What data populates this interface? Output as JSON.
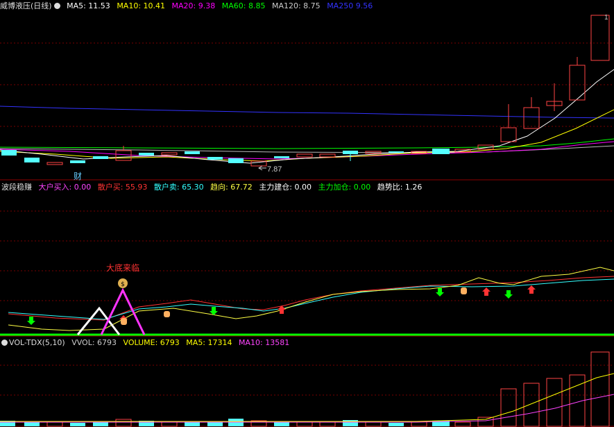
{
  "main_panel": {
    "title": "威博液压",
    "period": "(日线)",
    "ma": [
      {
        "label": "MA5: 11.53",
        "color": "#ffffff"
      },
      {
        "label": "MA10: 10.41",
        "color": "#ffff00"
      },
      {
        "label": "MA20: 9.38",
        "color": "#ff00ff"
      },
      {
        "label": "MA60: 8.85",
        "color": "#00ff00"
      },
      {
        "label": "MA120: 8.75",
        "color": "#cccccc"
      },
      {
        "label": "MA250 9.56",
        "color": "#3333ff"
      }
    ],
    "low_marker": "7.87",
    "finance_marker": "财",
    "top_marker": "1"
  },
  "indicator_panel": {
    "title": "波段稳赚",
    "items": [
      {
        "label": "大户买入: 0.00",
        "color": "#ff44ff"
      },
      {
        "label": "散户买: 55.93",
        "color": "#ff3333"
      },
      {
        "label": "散户卖: 65.30",
        "color": "#33ffff"
      },
      {
        "label": "趋向: 67.72",
        "color": "#ffff44"
      },
      {
        "label": "主力建仓: 0.00",
        "color": "#ffffff"
      },
      {
        "label": "主力加仓: 0.00",
        "color": "#00ff00"
      },
      {
        "label": "趋势比: 1.26",
        "color": "#ffffff"
      }
    ],
    "annotation": "大底来临"
  },
  "volume_panel": {
    "title": "VOL-TDX(5,10)",
    "items": [
      {
        "label": "VVOL: 6793",
        "color": "#cccccc"
      },
      {
        "label": "VOLUME: 6793",
        "color": "#ffff00"
      },
      {
        "label": "MA5: 17314",
        "color": "#ffff00"
      },
      {
        "label": "MA10: 13581",
        "color": "#ff44ff"
      }
    ]
  },
  "chart_data": [
    {
      "type": "candlestick",
      "title": "威博液压 (日线)",
      "series": [
        {
          "name": "MA5",
          "value": 11.53
        },
        {
          "name": "MA10",
          "value": 10.41
        },
        {
          "name": "MA20",
          "value": 9.38
        },
        {
          "name": "MA60",
          "value": 8.85
        },
        {
          "name": "MA120",
          "value": 8.75
        },
        {
          "name": "MA250",
          "value": 9.56
        }
      ],
      "low_label": 7.87
    },
    {
      "type": "line",
      "title": "波段稳赚",
      "series": [
        {
          "name": "大户买入",
          "value": 0.0
        },
        {
          "name": "散户买",
          "value": 55.93
        },
        {
          "name": "散户卖",
          "value": 65.3
        },
        {
          "name": "趋向",
          "value": 67.72
        },
        {
          "name": "主力建仓",
          "value": 0.0
        },
        {
          "name": "主力加仓",
          "value": 0.0
        },
        {
          "name": "趋势比",
          "value": 1.26
        }
      ]
    },
    {
      "type": "bar",
      "title": "VOL-TDX(5,10)",
      "series": [
        {
          "name": "VVOL",
          "value": 6793
        },
        {
          "name": "VOLUME",
          "value": 6793
        },
        {
          "name": "MA5",
          "value": 17314
        },
        {
          "name": "MA10",
          "value": 13581
        }
      ]
    }
  ]
}
